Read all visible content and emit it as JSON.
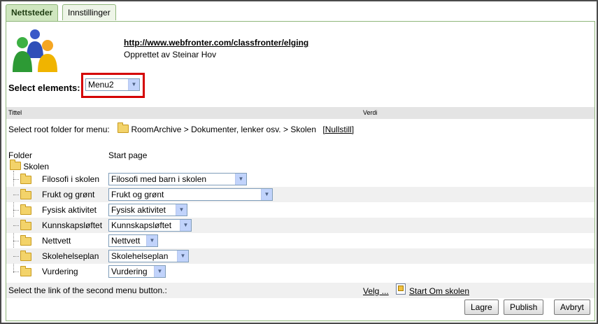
{
  "tabs": [
    {
      "label": "Nettsteder",
      "active": true
    },
    {
      "label": "Innstillinger",
      "active": false
    }
  ],
  "site": {
    "url": "http://www.webfronter.com/classfronter/elging",
    "creator": "Opprettet av Steinar Hov"
  },
  "select_elements": {
    "label": "Select elements:",
    "value": "Menu2"
  },
  "table_header": {
    "col1": "Tittel",
    "col2": "Verdi"
  },
  "root_folder": {
    "label": "Select root folder for menu:",
    "path": "RoomArchive > Dokumenter, lenker osv. > Skolen",
    "reset": "[Nullstill]"
  },
  "columns": {
    "folder": "Folder",
    "start_page": "Start page"
  },
  "root_name": "Skolen",
  "folders": [
    {
      "name": "Filosofi i skolen",
      "start_page": "Filosofi med barn i skolen"
    },
    {
      "name": "Frukt og grønt",
      "start_page": "Frukt og grønt"
    },
    {
      "name": "Fysisk aktivitet",
      "start_page": "Fysisk aktivitet"
    },
    {
      "name": "Kunnskapsløftet",
      "start_page": "Kunnskapsløftet"
    },
    {
      "name": "Nettvett",
      "start_page": "Nettvett"
    },
    {
      "name": "Skolehelseplan",
      "start_page": "Skolehelseplan"
    },
    {
      "name": "Vurdering",
      "start_page": "Vurdering"
    }
  ],
  "second_menu": {
    "label": "Select the link of the second menu button.:",
    "velg": "Velg ...",
    "start_link": "Start Om skolen"
  },
  "buttons": {
    "save": "Lagre",
    "publish": "Publish",
    "cancel": "Avbryt"
  },
  "colors": {
    "highlight": "#d40000",
    "tab_active": "#cfe6bf",
    "tab_border": "#8fb67a"
  }
}
